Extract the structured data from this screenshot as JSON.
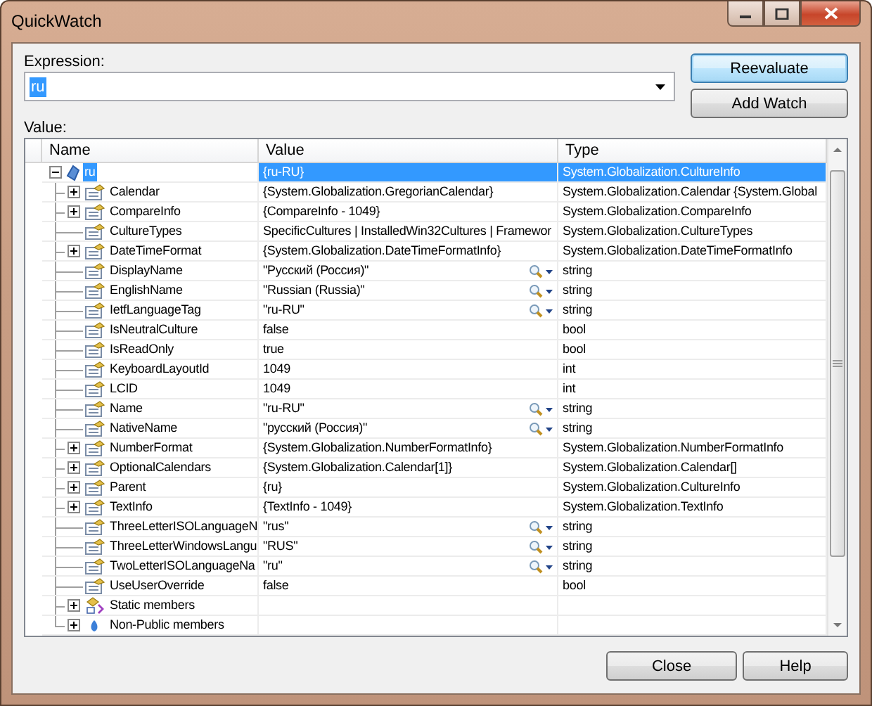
{
  "window": {
    "title": "QuickWatch"
  },
  "expression": {
    "label": "Expression:",
    "value": "ru"
  },
  "buttons": {
    "reevaluate": "Reevaluate",
    "add_watch": "Add Watch",
    "close": "Close",
    "help": "Help"
  },
  "value_label": "Value:",
  "table": {
    "columns": [
      "Name",
      "Value",
      "Type"
    ],
    "rows": [
      {
        "name": "ru",
        "value": "{ru-RU}",
        "type": "System.Globalization.CultureInfo",
        "kind": "object",
        "expanded": true,
        "selected": true,
        "visualizer": false,
        "children": [
          {
            "name": "Calendar",
            "value": "{System.Globalization.GregorianCalendar}",
            "type": "System.Globalization.Calendar {System.Global",
            "kind": "property",
            "expanded": false,
            "selected": false,
            "visualizer": false
          },
          {
            "name": "CompareInfo",
            "value": "{CompareInfo - 1049}",
            "type": "System.Globalization.CompareInfo",
            "kind": "property",
            "expanded": false,
            "selected": false,
            "visualizer": false
          },
          {
            "name": "CultureTypes",
            "value": "SpecificCultures | InstalledWin32Cultures | Framewor",
            "type": "System.Globalization.CultureTypes",
            "kind": "property",
            "selected": false,
            "visualizer": false
          },
          {
            "name": "DateTimeFormat",
            "value": "{System.Globalization.DateTimeFormatInfo}",
            "type": "System.Globalization.DateTimeFormatInfo",
            "kind": "property",
            "expanded": false,
            "selected": false,
            "visualizer": false
          },
          {
            "name": "DisplayName",
            "value": "\"Русский (Россия)\"",
            "type": "string",
            "kind": "property",
            "selected": false,
            "visualizer": true
          },
          {
            "name": "EnglishName",
            "value": "\"Russian (Russia)\"",
            "type": "string",
            "kind": "property",
            "selected": false,
            "visualizer": true
          },
          {
            "name": "IetfLanguageTag",
            "value": "\"ru-RU\"",
            "type": "string",
            "kind": "property",
            "selected": false,
            "visualizer": true
          },
          {
            "name": "IsNeutralCulture",
            "value": "false",
            "type": "bool",
            "kind": "property",
            "selected": false,
            "visualizer": false
          },
          {
            "name": "IsReadOnly",
            "value": "true",
            "type": "bool",
            "kind": "property",
            "selected": false,
            "visualizer": false
          },
          {
            "name": "KeyboardLayoutId",
            "value": "1049",
            "type": "int",
            "kind": "property",
            "selected": false,
            "visualizer": false
          },
          {
            "name": "LCID",
            "value": "1049",
            "type": "int",
            "kind": "property",
            "selected": false,
            "visualizer": false
          },
          {
            "name": "Name",
            "value": "\"ru-RU\"",
            "type": "string",
            "kind": "property",
            "selected": false,
            "visualizer": true
          },
          {
            "name": "NativeName",
            "value": "\"русский (Россия)\"",
            "type": "string",
            "kind": "property",
            "selected": false,
            "visualizer": true
          },
          {
            "name": "NumberFormat",
            "value": "{System.Globalization.NumberFormatInfo}",
            "type": "System.Globalization.NumberFormatInfo",
            "kind": "property",
            "expanded": false,
            "selected": false,
            "visualizer": false
          },
          {
            "name": "OptionalCalendars",
            "value": "{System.Globalization.Calendar[1]}",
            "type": "System.Globalization.Calendar[]",
            "kind": "property",
            "expanded": false,
            "selected": false,
            "visualizer": false
          },
          {
            "name": "Parent",
            "value": "{ru}",
            "type": "System.Globalization.CultureInfo",
            "kind": "property",
            "expanded": false,
            "selected": false,
            "visualizer": false
          },
          {
            "name": "TextInfo",
            "value": "{TextInfo - 1049}",
            "type": "System.Globalization.TextInfo",
            "kind": "property",
            "expanded": false,
            "selected": false,
            "visualizer": false
          },
          {
            "name": "ThreeLetterISOLanguageN",
            "value": "\"rus\"",
            "type": "string",
            "kind": "property",
            "selected": false,
            "visualizer": true
          },
          {
            "name": "ThreeLetterWindowsLangu",
            "value": "\"RUS\"",
            "type": "string",
            "kind": "property",
            "selected": false,
            "visualizer": true
          },
          {
            "name": "TwoLetterISOLanguageNa",
            "value": "\"ru\"",
            "type": "string",
            "kind": "property",
            "selected": false,
            "visualizer": true
          },
          {
            "name": "UseUserOverride",
            "value": "false",
            "type": "bool",
            "kind": "property",
            "selected": false,
            "visualizer": false
          },
          {
            "name": "Static members",
            "kind": "static",
            "expanded": false,
            "selected": false,
            "visualizer": false
          },
          {
            "name": "Non-Public members",
            "kind": "nonpublic",
            "expanded": false,
            "selected": false,
            "visualizer": false
          }
        ]
      }
    ]
  }
}
